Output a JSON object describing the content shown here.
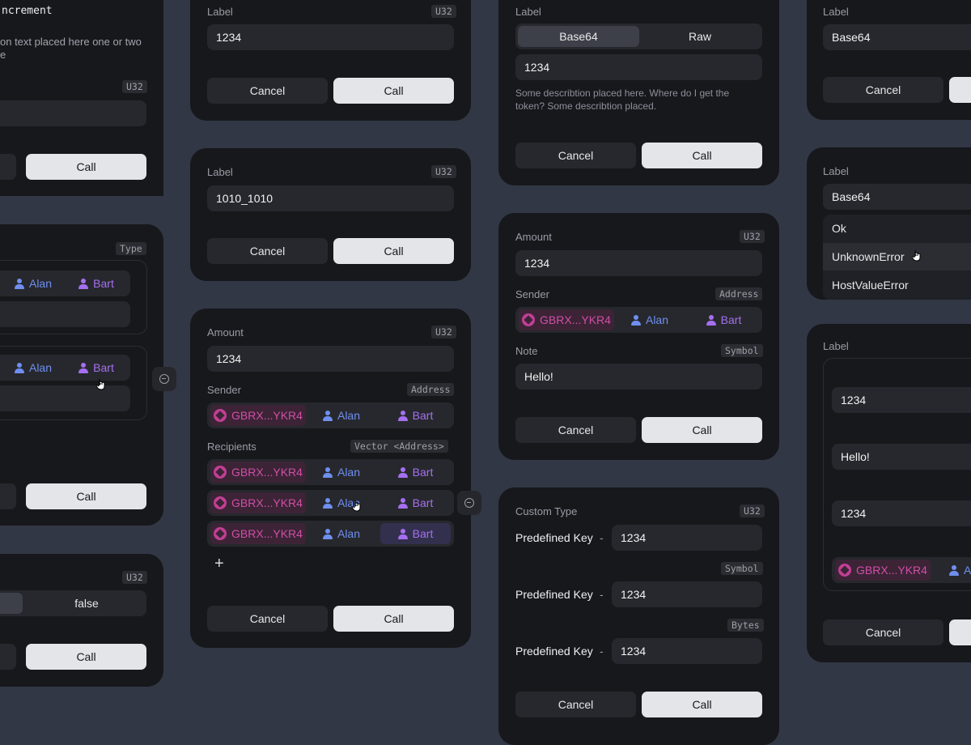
{
  "common": {
    "cancel": "Cancel",
    "call": "Call",
    "label": "Label",
    "alan": "Alan",
    "bart": "Bart",
    "gbrx": "GBRX...YKR4"
  },
  "col1": {
    "card1": {
      "title": "ncrement",
      "desc": "on text placed here one or two\ne",
      "tag": "U32"
    },
    "card2": {
      "tag": "Type"
    },
    "card3": {
      "tag": "U32",
      "value": "false"
    }
  },
  "col2": {
    "card1": {
      "tag": "U32",
      "value": "1234"
    },
    "card2": {
      "tag": "U32",
      "value": "1010_1010"
    },
    "card3": {
      "amount_label": "Amount",
      "amount_tag": "U32",
      "amount_value": "1234",
      "sender_label": "Sender",
      "sender_tag": "Address",
      "recipients_label": "Recipients",
      "recipients_tag": "Vector <Address>",
      "add": "+"
    }
  },
  "col3": {
    "card1": {
      "seg_base64": "Base64",
      "seg_raw": "Raw",
      "value": "1234",
      "desc": "Some describtion placed here. Where do I get the token? Some describtion placed."
    },
    "card2": {
      "amount_label": "Amount",
      "amount_tag": "U32",
      "amount_value": "1234",
      "sender_label": "Sender",
      "sender_tag": "Address",
      "note_label": "Note",
      "note_tag": "Symbol",
      "note_value": "Hello!"
    },
    "card3": {
      "title": "Custom Type",
      "tag1": "U32",
      "tag2": "Symbol",
      "tag3": "Bytes",
      "key": "Predefined Key",
      "dash": "-",
      "value": "1234"
    }
  },
  "col4": {
    "card1": {
      "value": "Base64"
    },
    "card2": {
      "value": "Base64",
      "menu": [
        "Ok",
        "UnknownError",
        "HostValueError"
      ]
    },
    "card3": {
      "v1": "1234",
      "v2": "Hello!",
      "v3": "1234"
    }
  }
}
